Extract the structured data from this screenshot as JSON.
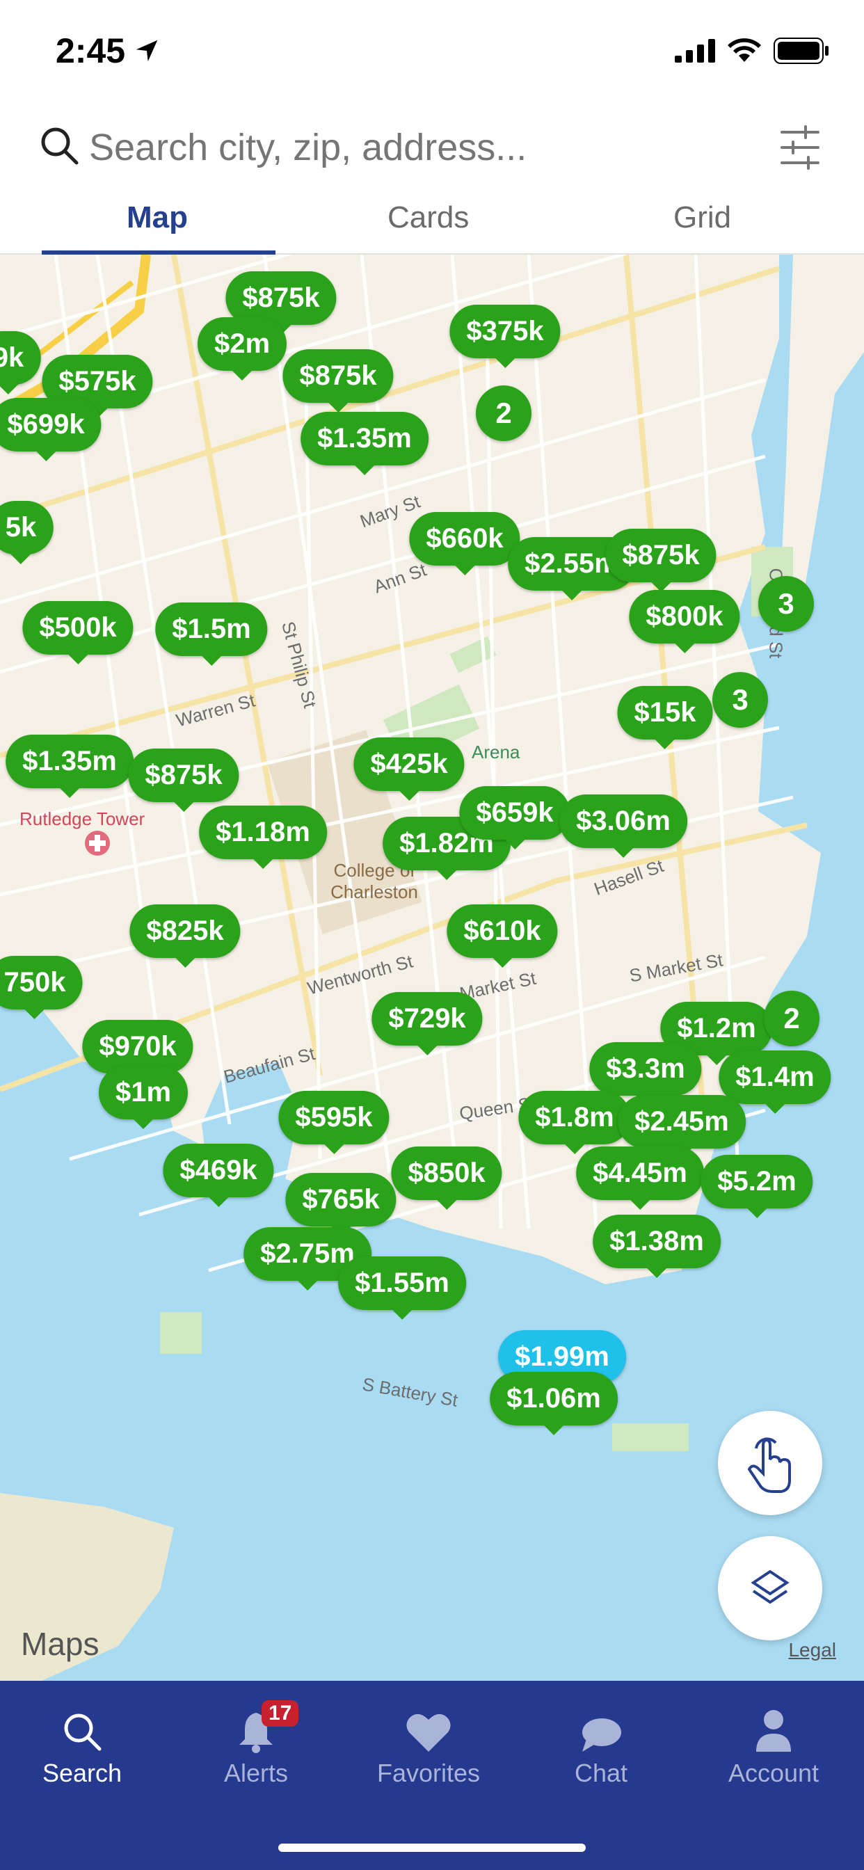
{
  "status_bar": {
    "time": "2:45"
  },
  "search": {
    "placeholder": "Search city, zip, address..."
  },
  "view_tabs": [
    {
      "label": "Map",
      "active": true
    },
    {
      "label": "Cards",
      "active": false
    },
    {
      "label": "Grid",
      "active": false
    }
  ],
  "map": {
    "labels": [
      "Rutledge Tower",
      "College of Charleston",
      "Arena",
      "Hasell St",
      "Warren St",
      "Wentworth St",
      "Beaufain St",
      "Queen St",
      "S Market St",
      "Market St",
      "S Battery St",
      "Mary St",
      "Ann St",
      "St Philip St",
      "Concord St"
    ],
    "pins": [
      "$875k",
      "$2m",
      "$875k",
      "$375k",
      "9k",
      "$575k",
      "$699k",
      "$1.35m",
      "5k",
      "$660k",
      "$2.55m",
      "$875k",
      "$500k",
      "$1.5m",
      "$800k",
      "$15k",
      "$1.35m",
      "$875k",
      "$425k",
      "$1.18m",
      "$1.82m",
      "$659k",
      "$3.06m",
      "$825k",
      "$610k",
      "750k",
      "$729k",
      "$970k",
      "$1.2m",
      "$3.3m",
      "$1.4m",
      "$1m",
      "$595k",
      "$1.8m",
      "$2.45m",
      "$469k",
      "$850k",
      "$4.45m",
      "$5.2m",
      "$765k",
      "$1.38m",
      "$2.75m",
      "$1.55m",
      "$1.99m",
      "$1.06m"
    ],
    "clusters": [
      "2",
      "3",
      "3",
      "2"
    ],
    "attribution": "Maps",
    "legal": "Legal"
  },
  "tab_bar": [
    {
      "label": "Search",
      "icon": "search-icon",
      "active": true
    },
    {
      "label": "Alerts",
      "icon": "bell-icon",
      "badge": "17",
      "active": false
    },
    {
      "label": "Favorites",
      "icon": "heart-icon",
      "active": false
    },
    {
      "label": "Chat",
      "icon": "chat-bubble-icon",
      "active": false
    },
    {
      "label": "Account",
      "icon": "person-icon",
      "active": false
    }
  ],
  "colors": {
    "accent": "#25408f",
    "pin_green": "#2aa31a",
    "pin_selected": "#1fc1ea",
    "tab_bar_bg": "#25398e",
    "badge": "#c8202f"
  }
}
